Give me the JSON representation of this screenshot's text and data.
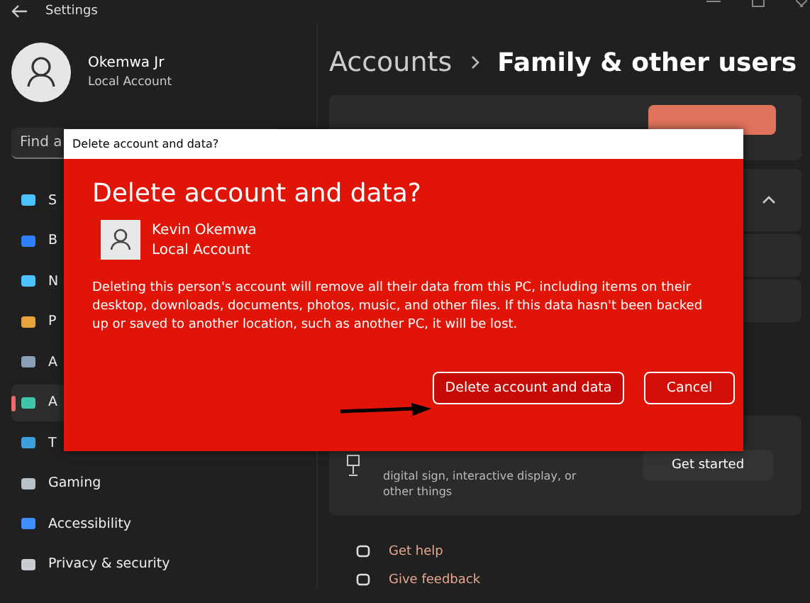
{
  "window": {
    "title": "Settings"
  },
  "profile": {
    "name": "Okemwa Jr",
    "account_type": "Local Account"
  },
  "search": {
    "placeholder": "Find a"
  },
  "sidebar": {
    "items": [
      {
        "label": "S",
        "selected": false
      },
      {
        "label": "B",
        "selected": false
      },
      {
        "label": "N",
        "selected": false
      },
      {
        "label": "P",
        "selected": false
      },
      {
        "label": "A",
        "selected": false
      },
      {
        "label": "A",
        "selected": true
      },
      {
        "label": "T",
        "selected": false
      },
      {
        "label": "Gaming",
        "selected": false
      },
      {
        "label": "Accessibility",
        "selected": false
      },
      {
        "label": "Privacy & security",
        "selected": false
      }
    ]
  },
  "breadcrumb": {
    "parent": "Accounts",
    "current": "Family & other users"
  },
  "kiosk": {
    "description": "digital sign, interactive display, or other things",
    "button": "Get started"
  },
  "links": [
    "Get help",
    "Give feedback"
  ],
  "dialog": {
    "title_bar": "Delete account and data?",
    "heading": "Delete account and data?",
    "user": {
      "name": "Kevin Okemwa",
      "account_type": "Local Account"
    },
    "message": "Deleting this person's account will remove all their data from this PC, including items on their desktop, downloads, documents, photos, music, and other files. If this data hasn't been backed up or saved to another location, such as another PC, it will be lost.",
    "buttons": [
      {
        "label": "Delete account and data",
        "kind": "primary"
      },
      {
        "label": "Cancel",
        "kind": "secondary"
      }
    ]
  }
}
